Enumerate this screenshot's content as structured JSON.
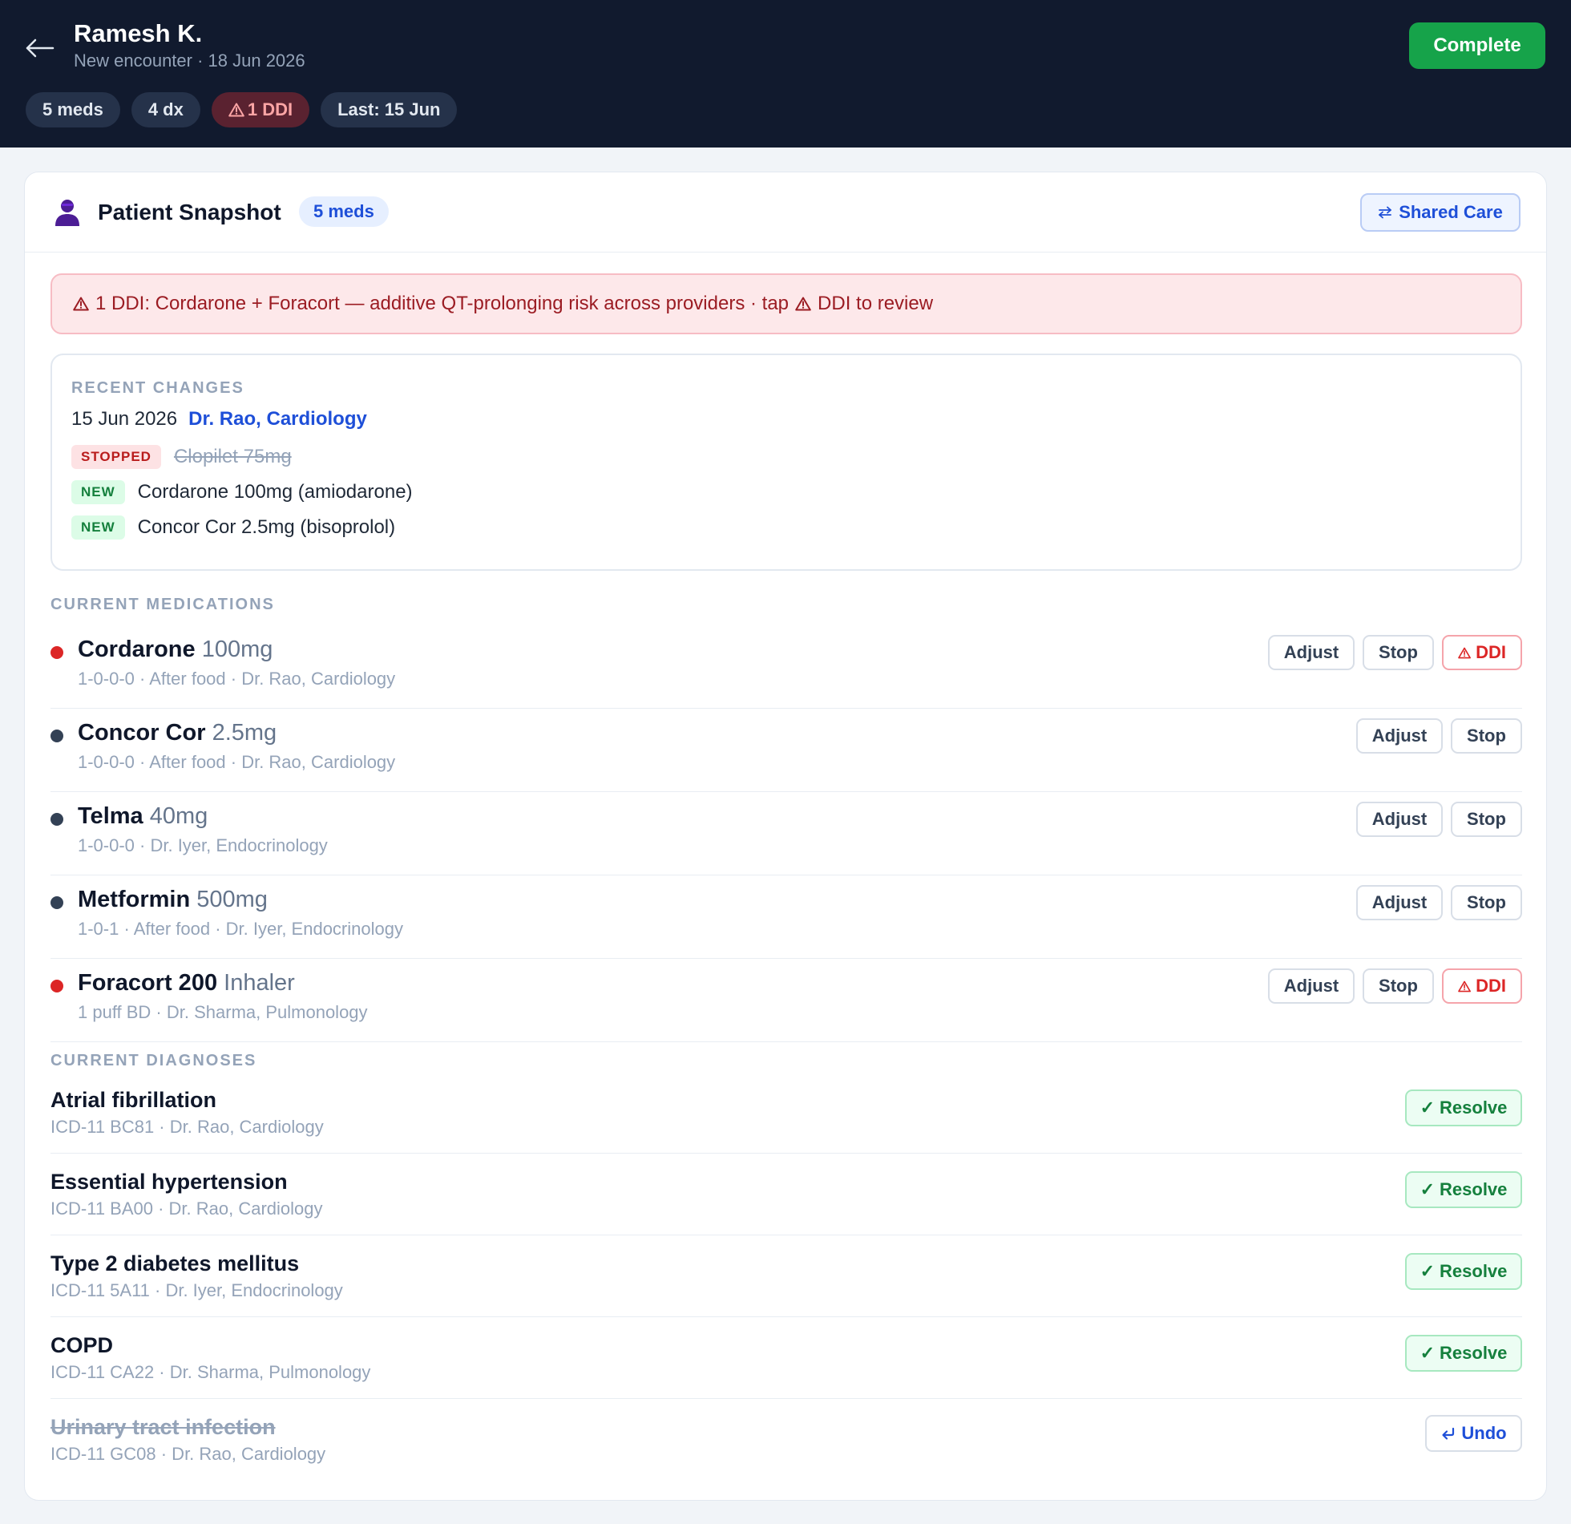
{
  "header": {
    "patient_name": "Ramesh K.",
    "encounter": "New encounter · 18 Jun 2026",
    "complete_label": "Complete",
    "chips": {
      "meds": "5 meds",
      "dx": "4 dx",
      "ddi": "1 DDI",
      "last": "Last: 15 Jun"
    }
  },
  "snapshot": {
    "title": "Patient Snapshot",
    "badge": "5 meds",
    "shared_care_label": "Shared Care"
  },
  "ddi_banner": {
    "prefix": "1 DDI: Cordarone + Foracort — additive QT-prolonging risk across providers · tap",
    "suffix": "DDI to review"
  },
  "recent_changes": {
    "label": "Recent Changes",
    "date": "15 Jun 2026",
    "doctor": "Dr. Rao, Cardiology",
    "items": [
      {
        "tag": "STOPPED",
        "text": "Clopilet 75mg"
      },
      {
        "tag": "NEW",
        "text": "Cordarone 100mg (amiodarone)"
      },
      {
        "tag": "NEW",
        "text": "Concor Cor 2.5mg (bisoprolol)"
      }
    ]
  },
  "medications": {
    "label": "Current Medications",
    "adjust_label": "Adjust",
    "stop_label": "Stop",
    "ddi_label": "DDI",
    "items": [
      {
        "name": "Cordarone",
        "dose": "100mg",
        "details": "1-0-0-0 · After food · Dr. Rao, Cardiology",
        "ddi": true,
        "dot_color": "#dc2626"
      },
      {
        "name": "Concor Cor",
        "dose": "2.5mg",
        "details": "1-0-0-0 · After food · Dr. Rao, Cardiology",
        "ddi": false,
        "dot_color": "#334155"
      },
      {
        "name": "Telma",
        "dose": "40mg",
        "details": "1-0-0-0 · Dr. Iyer, Endocrinology",
        "ddi": false,
        "dot_color": "#334155"
      },
      {
        "name": "Metformin",
        "dose": "500mg",
        "details": "1-0-1 · After food · Dr. Iyer, Endocrinology",
        "ddi": false,
        "dot_color": "#334155"
      },
      {
        "name": "Foracort 200",
        "dose": "Inhaler",
        "details": "1 puff BD · Dr. Sharma, Pulmonology",
        "ddi": true,
        "dot_color": "#dc2626"
      }
    ]
  },
  "diagnoses": {
    "label": "Current Diagnoses",
    "resolve_label": "Resolve",
    "undo_label": "Undo",
    "items": [
      {
        "name": "Atrial fibrillation",
        "details": "ICD-11 BC81 · Dr. Rao, Cardiology",
        "resolved": false
      },
      {
        "name": "Essential hypertension",
        "details": "ICD-11 BA00 · Dr. Rao, Cardiology",
        "resolved": false
      },
      {
        "name": "Type 2 diabetes mellitus",
        "details": "ICD-11 5A11 · Dr. Iyer, Endocrinology",
        "resolved": false
      },
      {
        "name": "COPD",
        "details": "ICD-11 CA22 · Dr. Sharma, Pulmonology",
        "resolved": false
      },
      {
        "name": "Urinary tract infection",
        "details": "ICD-11 GC08 · Dr. Rao, Cardiology",
        "resolved": true
      }
    ]
  },
  "colors": {
    "header_bg": "#111a2e",
    "complete_green": "#16a34a",
    "ddi_red": "#dc2626",
    "link_blue": "#1e4fd8"
  }
}
